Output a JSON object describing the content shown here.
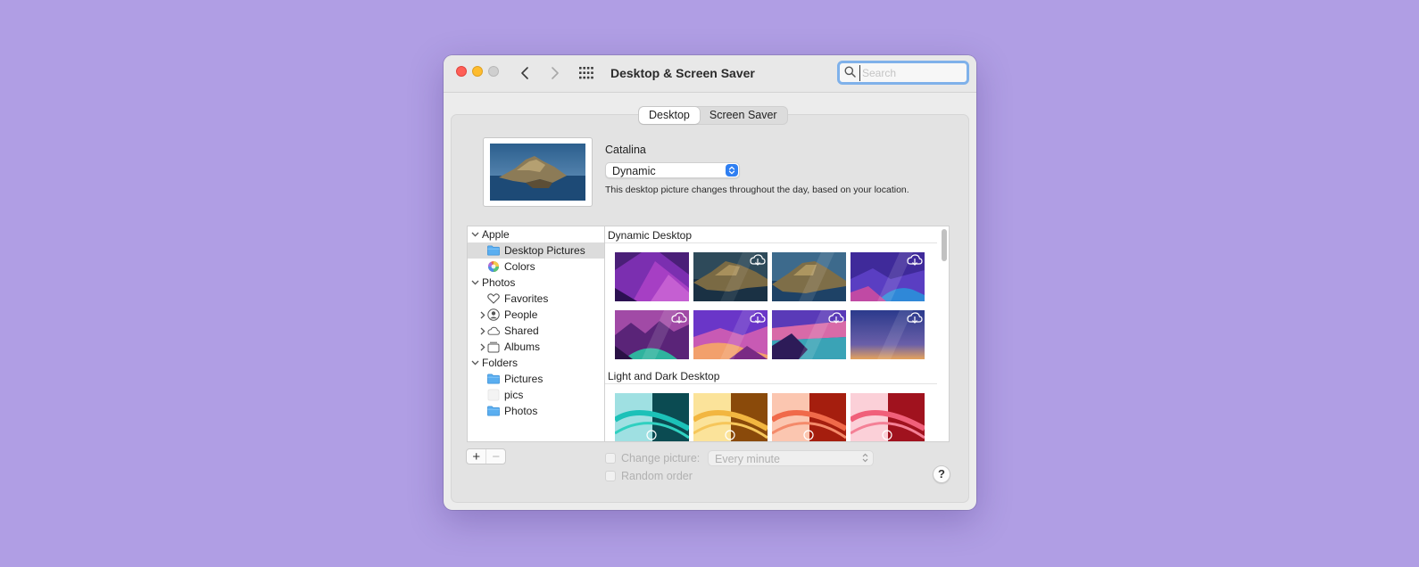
{
  "window": {
    "title": "Desktop & Screen Saver",
    "search": {
      "placeholder": "Search",
      "value": ""
    }
  },
  "tabs": [
    {
      "label": "Desktop",
      "active": true
    },
    {
      "label": "Screen Saver",
      "active": false
    }
  ],
  "current_picture": {
    "name": "Catalina",
    "mode": "Dynamic",
    "description": "This desktop picture changes throughout the day, based on your location."
  },
  "sidebar": {
    "groups": [
      {
        "label": "Apple",
        "items": [
          "Desktop Pictures",
          "Colors"
        ]
      },
      {
        "label": "Photos",
        "items": [
          "Favorites",
          "People",
          "Shared",
          "Albums"
        ]
      },
      {
        "label": "Folders",
        "items": [
          "Pictures",
          "pics",
          "Photos"
        ]
      }
    ],
    "selected": "Desktop Pictures"
  },
  "gallery": {
    "sections": [
      {
        "title": "Dynamic Desktop",
        "count": 8,
        "cloud_icons": [
          false,
          true,
          false,
          true,
          true,
          true,
          true,
          true
        ]
      },
      {
        "title": "Light and Dark Desktop",
        "count": 4
      }
    ]
  },
  "controls": {
    "add_label": "+",
    "remove_label": "−",
    "change_picture_label": "Change picture:",
    "change_picture_checked": false,
    "interval_value": "Every minute",
    "random_order_label": "Random order",
    "random_order_checked": false,
    "help_label": "?"
  },
  "colors": {
    "background": "#b09ee4",
    "accent": "#2f7ff2",
    "search_focus_ring": "#7fb1ea",
    "traffic_close": "#ff5f57",
    "traffic_minimize": "#febc2e"
  }
}
